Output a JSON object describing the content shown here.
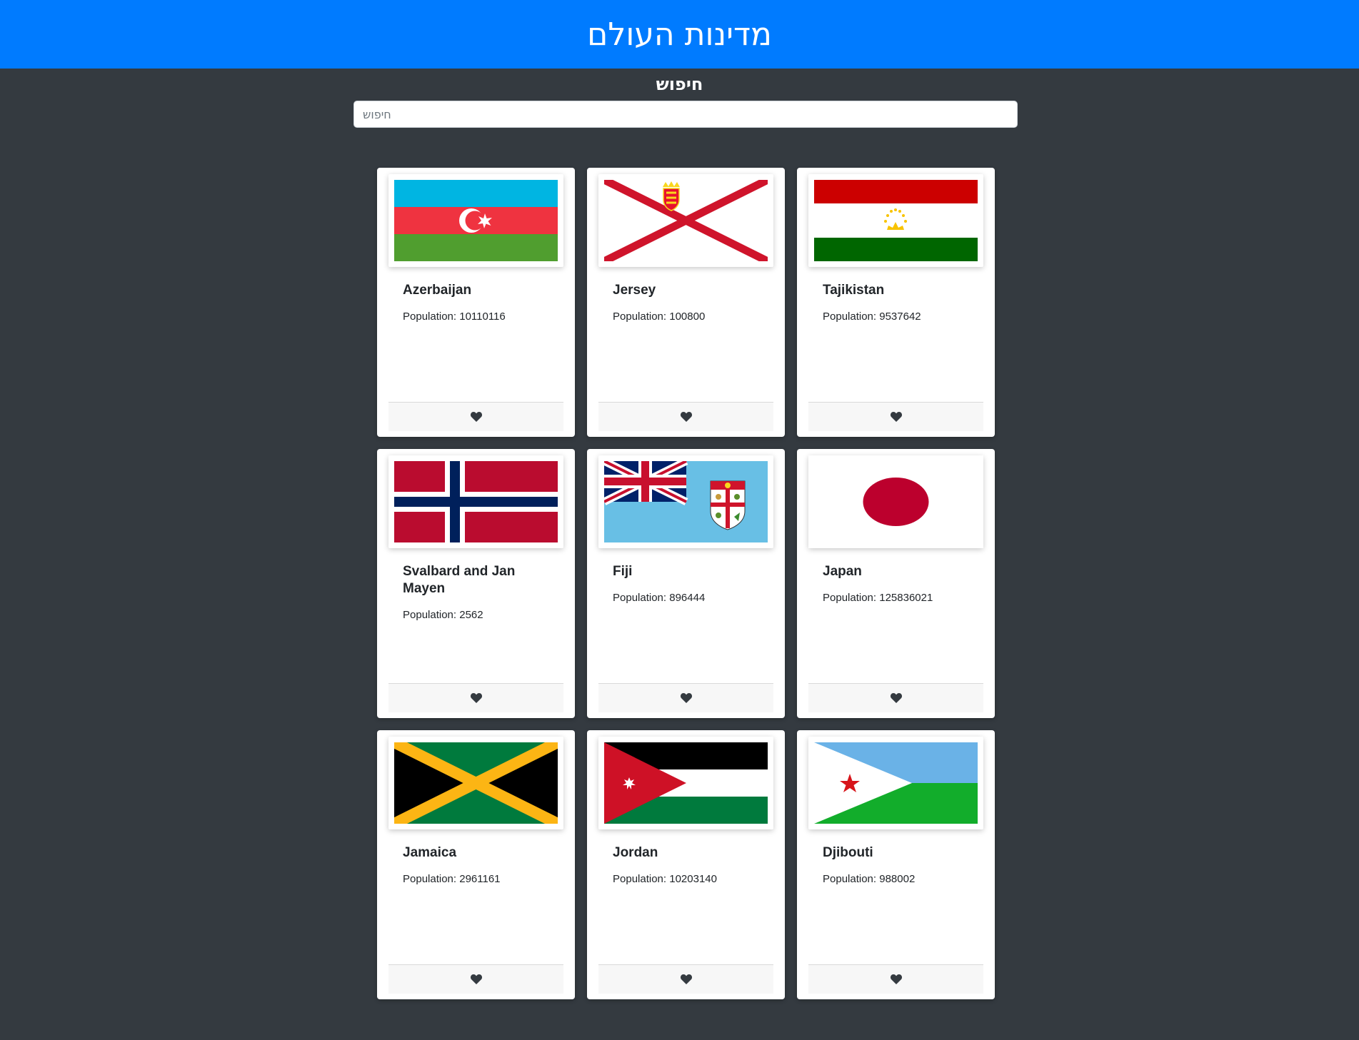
{
  "header": {
    "title": "מדינות העולם"
  },
  "search": {
    "label": "חיפוש",
    "placeholder": "חיפוש"
  },
  "countries": [
    {
      "name": "Azerbaijan",
      "population_text": "Population: 10110116",
      "flag_icon": "azerbaijan-flag"
    },
    {
      "name": "Jersey",
      "population_text": "Population: 100800",
      "flag_icon": "jersey-flag"
    },
    {
      "name": "Tajikistan",
      "population_text": "Population: 9537642",
      "flag_icon": "tajikistan-flag"
    },
    {
      "name": "Svalbard and Jan Mayen",
      "population_text": "Population: 2562",
      "flag_icon": "svalbard-flag"
    },
    {
      "name": "Fiji",
      "population_text": "Population: 896444",
      "flag_icon": "fiji-flag"
    },
    {
      "name": "Japan",
      "population_text": "Population: 125836021",
      "flag_icon": "japan-flag"
    },
    {
      "name": "Jamaica",
      "population_text": "Population: 2961161",
      "flag_icon": "jamaica-flag"
    },
    {
      "name": "Jordan",
      "population_text": "Population: 10203140",
      "flag_icon": "jordan-flag"
    },
    {
      "name": "Djibouti",
      "population_text": "Population: 988002",
      "flag_icon": "djibouti-flag"
    }
  ],
  "favorite_icon": "heart-icon",
  "colors": {
    "header_bg": "#007bff",
    "page_bg": "#343a40",
    "card_bg": "#ffffff"
  }
}
